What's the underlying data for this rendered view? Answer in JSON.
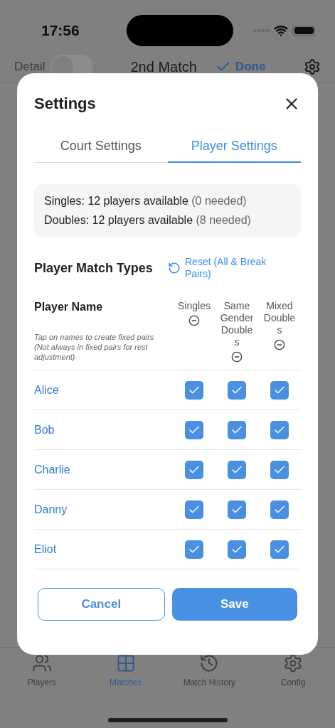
{
  "status_bar": {
    "time": "17:56"
  },
  "header": {
    "detail_label": "Detail",
    "detail_on": false,
    "title": "2nd Match",
    "done_label": "Done"
  },
  "modal": {
    "title": "Settings",
    "tabs": [
      {
        "label": "Court Settings",
        "selected": false
      },
      {
        "label": "Player Settings",
        "selected": true
      }
    ],
    "summary": [
      {
        "label": "Singles:",
        "text": "12 players available",
        "note": "(0 needed)"
      },
      {
        "label": "Doubles:",
        "text": "12 players available",
        "note": "(8 needed)"
      }
    ],
    "section_title": "Player Match Types",
    "reset_label": "Reset (All & Break Pairs)",
    "name_heading": "Player Name",
    "hint_lines": [
      "Tap on names to create fixed pairs",
      "(Not always in fixed pairs for rest adjustment)"
    ],
    "type_columns": [
      "Singles",
      "Same Gender Doubles",
      "Mixed Doubles"
    ],
    "players": [
      {
        "name": "Alice",
        "checks": [
          true,
          true,
          true
        ]
      },
      {
        "name": "Bob",
        "checks": [
          true,
          true,
          true
        ]
      },
      {
        "name": "Charlie",
        "checks": [
          true,
          true,
          true
        ]
      },
      {
        "name": "Danny",
        "checks": [
          true,
          true,
          true
        ]
      },
      {
        "name": "Eliot",
        "checks": [
          true,
          true,
          true
        ]
      }
    ],
    "cancel_label": "Cancel",
    "save_label": "Save"
  },
  "tab_bar": [
    {
      "kind": "players",
      "label": "Players",
      "selected": false
    },
    {
      "kind": "matches",
      "label": "Matches",
      "selected": true
    },
    {
      "kind": "history",
      "label": "Match History",
      "selected": false
    },
    {
      "kind": "config",
      "label": "Config",
      "selected": false
    }
  ]
}
